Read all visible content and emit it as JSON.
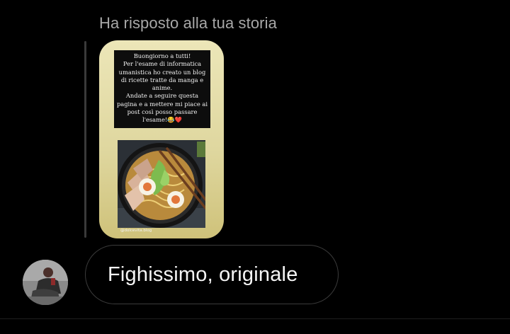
{
  "reply": {
    "header": "Ha risposto alla tua storia"
  },
  "story": {
    "text_lines": [
      "Buongiorno a tutti!",
      "Per l'esame di informatica",
      "umanistica ho creato un blog",
      "di ricette tratte da manga e",
      "anime.",
      "Andate a seguire questa",
      "pagina e a mettere mi piace ai",
      "post così posso passare",
      "l'esame!😂❤️"
    ],
    "photo_icon": "ramen-bowl-image",
    "credit": "@dolcevita.blog"
  },
  "message": {
    "avatar_icon": "user-avatar",
    "text": "Fighissimo, originale"
  },
  "colors": {
    "background": "#000000",
    "header_text": "#a8a8a8",
    "bubble_border": "#3b3b3b",
    "message_text": "#f5f5f5"
  }
}
